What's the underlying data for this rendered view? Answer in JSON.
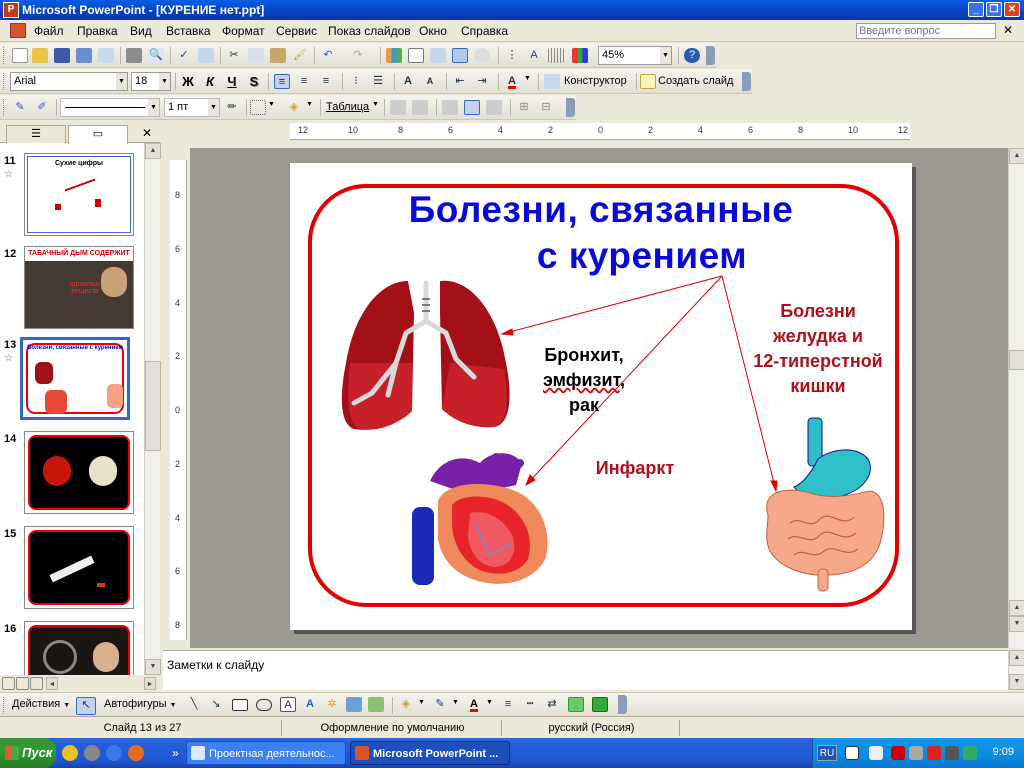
{
  "window": {
    "title": "Microsoft PowerPoint - [КУРЕНИЕ нет.ppt]",
    "controls": [
      "_",
      "❐",
      "✕"
    ]
  },
  "menu": {
    "items": [
      "Файл",
      "Правка",
      "Вид",
      "Вставка",
      "Формат",
      "Сервис",
      "Показ слайдов",
      "Окно",
      "Справка"
    ],
    "ask_placeholder": "Введите вопрос",
    "close_glyph": "✕"
  },
  "toolbar_standard": {
    "zoom": "45%",
    "help_glyph": "?"
  },
  "toolbar_formatting": {
    "font": "Arial",
    "size": "18",
    "bold": "Ж",
    "italic": "К",
    "underline": "Ч",
    "shadow": "S",
    "designer": "Конструктор",
    "new_slide": "Создать слайд"
  },
  "toolbar_tables": {
    "line_width": "1 пт",
    "table_label": "Таблица"
  },
  "left_panel": {
    "tab_outline_icon": "outline-icon",
    "tab_slides_icon": "slides-icon",
    "close_glyph": "✕",
    "slides": [
      {
        "number": "11",
        "title": "Сухие цифры",
        "star": "☆"
      },
      {
        "number": "12",
        "title": "ТАБАЧНЫЙ ДЫМ СОДЕРЖИТ",
        "subtitle": "ядовитых веществ",
        "star": ""
      },
      {
        "number": "13",
        "title": "Болезни, связанные с курением",
        "star": "☆"
      },
      {
        "number": "14",
        "title": "",
        "star": ""
      },
      {
        "number": "15",
        "title": "",
        "star": ""
      },
      {
        "number": "16",
        "title": "",
        "star": ""
      }
    ]
  },
  "ruler": {
    "top_ticks": [
      "12",
      "10",
      "8",
      "6",
      "4",
      "2",
      "0",
      "2",
      "4",
      "6",
      "8",
      "10",
      "12"
    ],
    "left_ticks": [
      "8",
      "6",
      "4",
      "2",
      "0",
      "2",
      "4",
      "6",
      "8"
    ]
  },
  "slide": {
    "title_line1": "Болезни, связанные",
    "title_line2": "с курением",
    "label_lungs": "Бронхит, эмфизит, рак",
    "label_lungs_l1": "Бронхит,",
    "label_lungs_l2": "эмфизит,",
    "label_lungs_l3": "рак",
    "label_stomach_l1": "Болезни",
    "label_stomach_l2": "желудка и",
    "label_stomach_l3": "12-типерстной",
    "label_stomach_l4": "кишки",
    "label_heart": "Инфаркт",
    "colors": {
      "title": "#0a0ad8",
      "frame": "#e40000",
      "label_dark_red": "#b0101a",
      "label_black": "#000000"
    }
  },
  "notes": {
    "placeholder": "Заметки к слайду"
  },
  "drawing_toolbar": {
    "actions": "Действия",
    "autoshapes": "Автофигуры"
  },
  "status": {
    "slide_count": "Слайд 13 из 27",
    "design": "Оформление по умолчанию",
    "language": "русский (Россия)"
  },
  "taskbar": {
    "start": "Пуск",
    "tasks": [
      {
        "label": "Проектная деятельнос...",
        "active": false
      },
      {
        "label": "Microsoft PowerPoint ...",
        "active": true
      }
    ],
    "lang": "RU",
    "clock": "9:09"
  }
}
